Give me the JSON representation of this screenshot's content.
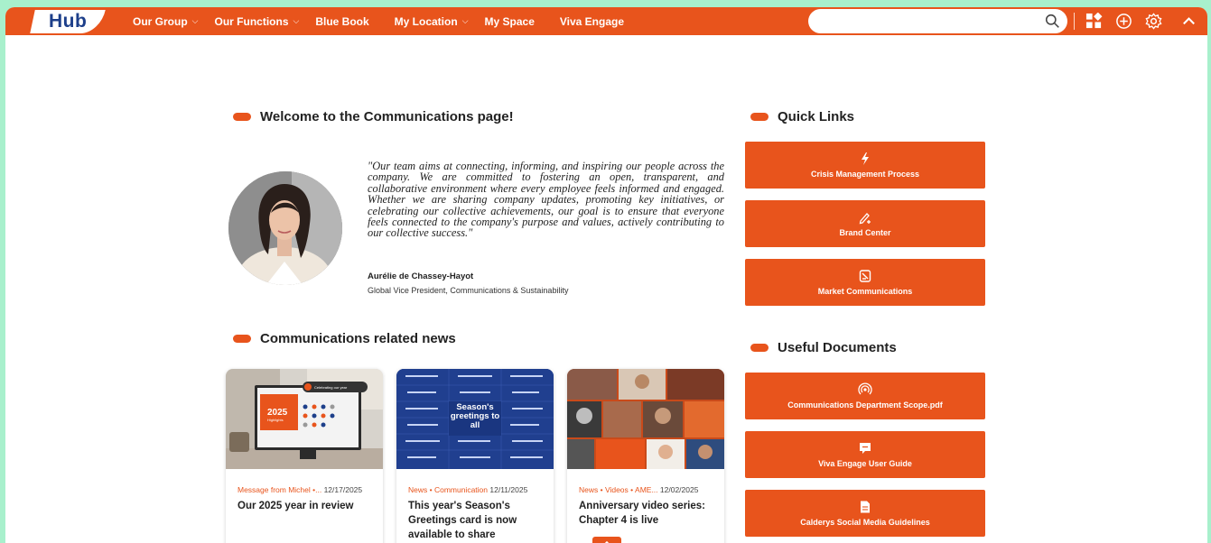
{
  "header": {
    "logo": "Hub",
    "nav": [
      {
        "label": "Our Group",
        "dropdown": true
      },
      {
        "label": "Our Functions",
        "dropdown": true
      },
      {
        "label": "Blue Book",
        "dropdown": false
      },
      {
        "label": "My Location",
        "dropdown": true
      },
      {
        "label": "My Space",
        "dropdown": false
      },
      {
        "label": "Viva Engage",
        "dropdown": false
      }
    ],
    "search": {
      "placeholder": "",
      "value": ""
    },
    "icons": [
      "apps-icon",
      "add-circle-icon",
      "settings-icon",
      "collapse-chevron-icon"
    ]
  },
  "welcome": {
    "title": "Welcome to the Communications page!",
    "quote": "\"Our team aims at connecting, informing, and inspiring our people across the company. We are committed to fostering an open, transparent, and collaborative environment where every employee feels informed and engaged. Whether we are sharing company updates, promoting key initiatives, or celebrating our collective achievements, our goal is to ensure that everyone feels connected to the company's purpose and values, actively contributing to our collective success.\"",
    "author": "Aurélie de Chassey-Hayot",
    "role": "Global Vice President, Communications & Sustainability"
  },
  "quick_links": {
    "title": "Quick Links",
    "items": [
      {
        "label": "Crisis Management Process",
        "icon": "lightning-icon"
      },
      {
        "label": "Brand Center",
        "icon": "pen-add-icon"
      },
      {
        "label": "Market Communications",
        "icon": "document-icon"
      }
    ]
  },
  "news": {
    "title": "Communications related news",
    "cards": [
      {
        "tags": "Message from Michel  •...",
        "date": "12/17/2025",
        "title": "Our 2025 year in review",
        "thumb_text": "2025",
        "thumb_subtext": "Highlights",
        "thumb_badge": "Celebrating our year"
      },
      {
        "tags": "News  •  Communication",
        "date": "12/11/2025",
        "title": "This year's Season's Greetings card is now available to share",
        "thumb_text": "Season's greetings to all"
      },
      {
        "tags": "News  •  Videos  •  AME...",
        "date": "12/02/2025",
        "title": "Anniversary video series: Chapter 4 is live"
      }
    ]
  },
  "documents": {
    "title": "Useful Documents",
    "items": [
      {
        "label": "Communications Department Scope.pdf",
        "icon": "broadcast-icon"
      },
      {
        "label": "Viva Engage User Guide",
        "icon": "chat-icon"
      },
      {
        "label": "Calderys Social Media Guidelines",
        "icon": "page-icon"
      }
    ]
  },
  "colors": {
    "accent": "#e8541c",
    "logo_blue": "#1d3f8a",
    "background": "#a8f0cc"
  }
}
